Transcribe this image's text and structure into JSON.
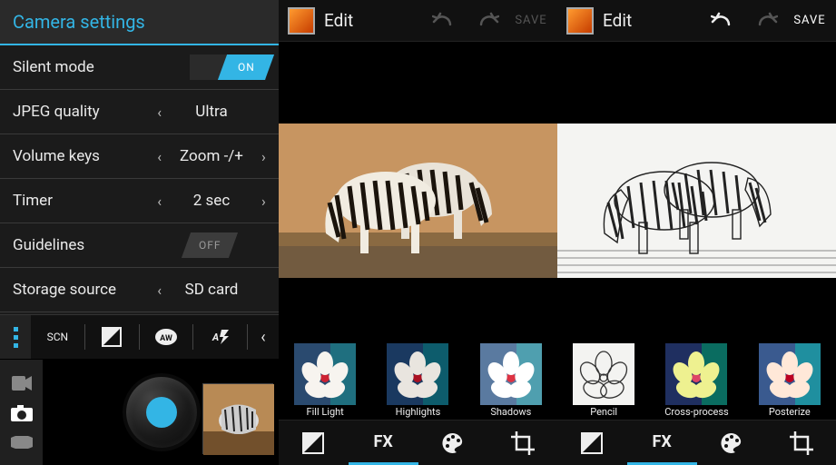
{
  "settings": {
    "title": "Camera settings",
    "rows": [
      {
        "label": "Silent mode",
        "value": "ON"
      },
      {
        "label": "JPEG quality",
        "value": "Ultra"
      },
      {
        "label": "Volume keys",
        "value": "Zoom -/+"
      },
      {
        "label": "Timer",
        "value": "2 sec"
      },
      {
        "label": "Guidelines",
        "value": "OFF"
      },
      {
        "label": "Storage source",
        "value": "SD card"
      }
    ],
    "toolbar": [
      "SCN",
      "exposure",
      "awb",
      "auto-flash"
    ],
    "scn": "SCN"
  },
  "editor_left": {
    "title": "Edit",
    "save": "SAVE",
    "effects": [
      "Fill Light",
      "Highlights",
      "Shadows"
    ],
    "active_tab": "FX",
    "tabs_fx": "FX"
  },
  "editor_right": {
    "title": "Edit",
    "save": "SAVE",
    "effects": [
      "Pencil",
      "Cross-process",
      "Posterize"
    ],
    "active_tab": "FX",
    "tabs_fx": "FX"
  },
  "colors": {
    "accent": "#33b5e5"
  }
}
